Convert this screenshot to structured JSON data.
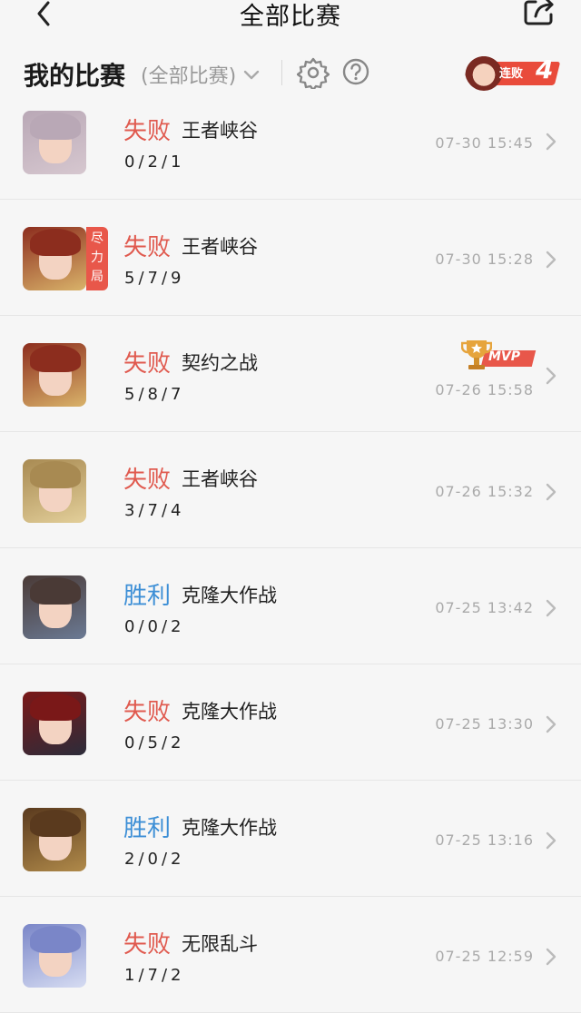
{
  "topbar": {
    "title": "全部比赛"
  },
  "header": {
    "title": "我的比赛",
    "filter_label": "(全部比赛)",
    "streak_label": "连败",
    "streak_count": "4"
  },
  "matches": [
    {
      "result": "失败",
      "result_type": "loss",
      "mode": "王者峡谷",
      "kda": "0/2/1",
      "time": "07-30 15:45",
      "tag": "",
      "mvp": false,
      "avatar_colors": [
        "#b9a8b6",
        "#d6c7cf"
      ]
    },
    {
      "result": "失败",
      "result_type": "loss",
      "mode": "王者峡谷",
      "kda": "5/7/9",
      "time": "07-30 15:28",
      "tag": "尽力局",
      "mvp": false,
      "avatar_colors": [
        "#8c2d1e",
        "#d9b36a"
      ]
    },
    {
      "result": "失败",
      "result_type": "loss",
      "mode": "契约之战",
      "kda": "5/8/7",
      "time": "07-26 15:58",
      "tag": "",
      "mvp": true,
      "mvp_label": "MVP",
      "avatar_colors": [
        "#8c2d1e",
        "#d9b36a"
      ]
    },
    {
      "result": "失败",
      "result_type": "loss",
      "mode": "王者峡谷",
      "kda": "3/7/4",
      "time": "07-26 15:32",
      "tag": "",
      "mvp": false,
      "avatar_colors": [
        "#a88a52",
        "#e3cf9a"
      ]
    },
    {
      "result": "胜利",
      "result_type": "win",
      "mode": "克隆大作战",
      "kda": "0/0/2",
      "time": "07-25 13:42",
      "tag": "",
      "mvp": false,
      "avatar_colors": [
        "#4a3a36",
        "#6b7a94"
      ]
    },
    {
      "result": "失败",
      "result_type": "loss",
      "mode": "克隆大作战",
      "kda": "0/5/2",
      "time": "07-25 13:30",
      "tag": "",
      "mvp": false,
      "avatar_colors": [
        "#7a1818",
        "#2c2c3a"
      ]
    },
    {
      "result": "胜利",
      "result_type": "win",
      "mode": "克隆大作战",
      "kda": "2/0/2",
      "time": "07-25 13:16",
      "tag": "",
      "mvp": false,
      "avatar_colors": [
        "#5a3a1e",
        "#b08a4a"
      ]
    },
    {
      "result": "失败",
      "result_type": "loss",
      "mode": "无限乱斗",
      "kda": "1/7/2",
      "time": "07-25 12:59",
      "tag": "",
      "mvp": false,
      "avatar_colors": [
        "#7a86c8",
        "#d6dcf2"
      ]
    }
  ],
  "colors": {
    "loss": "#e05a4f",
    "win": "#3d8fd6",
    "accent": "#e8574a"
  },
  "icons": {
    "back": "back-arrow-icon",
    "share": "share-icon",
    "filter": "chevron-down-icon",
    "settings": "gear-icon",
    "help": "help-icon",
    "row": "chevron-right-icon",
    "mvp": "trophy-icon"
  }
}
